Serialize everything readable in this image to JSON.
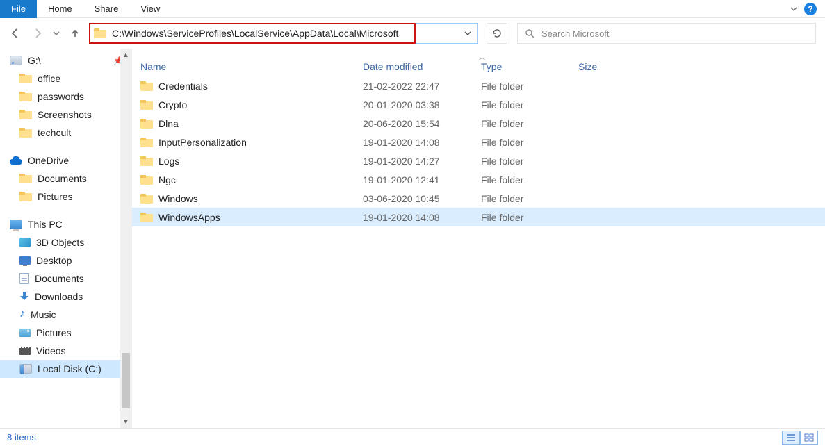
{
  "ribbon": {
    "tabs": [
      "File",
      "Home",
      "Share",
      "View"
    ]
  },
  "nav": {
    "address": "C:\\Windows\\ServiceProfiles\\LocalService\\AppData\\Local\\Microsoft",
    "search_placeholder": "Search Microsoft"
  },
  "sidebar": {
    "quick": [
      {
        "label": "G:\\",
        "icon": "drive"
      },
      {
        "label": "office",
        "icon": "folder"
      },
      {
        "label": "passwords",
        "icon": "folder"
      },
      {
        "label": "Screenshots",
        "icon": "folder"
      },
      {
        "label": "techcult",
        "icon": "folder"
      }
    ],
    "onedrive": {
      "label": "OneDrive",
      "children": [
        "Documents",
        "Pictures"
      ]
    },
    "thispc": {
      "label": "This PC",
      "children": [
        {
          "label": "3D Objects",
          "icon": "3d"
        },
        {
          "label": "Desktop",
          "icon": "desk"
        },
        {
          "label": "Documents",
          "icon": "docs"
        },
        {
          "label": "Downloads",
          "icon": "down"
        },
        {
          "label": "Music",
          "icon": "music"
        },
        {
          "label": "Pictures",
          "icon": "pic"
        },
        {
          "label": "Videos",
          "icon": "vid"
        },
        {
          "label": "Local Disk (C:)",
          "icon": "ldisk",
          "selected": true
        }
      ]
    }
  },
  "columns": {
    "name": "Name",
    "date": "Date modified",
    "type": "Type",
    "size": "Size"
  },
  "rows": [
    {
      "name": "Credentials",
      "date": "21-02-2022 22:47",
      "type": "File folder"
    },
    {
      "name": "Crypto",
      "date": "20-01-2020 03:38",
      "type": "File folder"
    },
    {
      "name": "Dlna",
      "date": "20-06-2020 15:54",
      "type": "File folder"
    },
    {
      "name": "InputPersonalization",
      "date": "19-01-2020 14:08",
      "type": "File folder"
    },
    {
      "name": "Logs",
      "date": "19-01-2020 14:27",
      "type": "File folder"
    },
    {
      "name": "Ngc",
      "date": "19-01-2020 12:41",
      "type": "File folder"
    },
    {
      "name": "Windows",
      "date": "03-06-2020 10:45",
      "type": "File folder"
    },
    {
      "name": "WindowsApps",
      "date": "19-01-2020 14:08",
      "type": "File folder",
      "selected": true
    }
  ],
  "status": {
    "count": "8 items"
  }
}
